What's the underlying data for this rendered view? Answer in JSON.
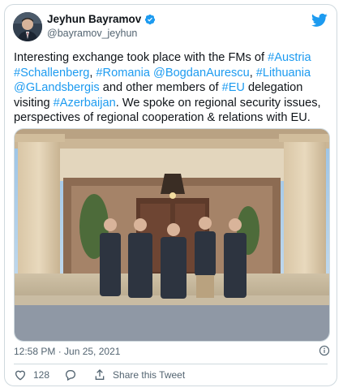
{
  "tweet": {
    "author": {
      "display_name": "Jeyhun Bayramov",
      "handle": "@bayramov_jeyhun",
      "verified": true
    },
    "text_segments": [
      {
        "t": "Interesting exchange took place with the FMs of ",
        "link": false
      },
      {
        "t": "#Austria",
        "link": true
      },
      {
        "t": " ",
        "link": false
      },
      {
        "t": "#Schallenberg",
        "link": true
      },
      {
        "t": ", ",
        "link": false
      },
      {
        "t": "#Romania",
        "link": true
      },
      {
        "t": " ",
        "link": false
      },
      {
        "t": "@BogdanAurescu",
        "link": true
      },
      {
        "t": ", ",
        "link": false
      },
      {
        "t": "#Lithuania",
        "link": true
      },
      {
        "t": " ",
        "link": false
      },
      {
        "t": "@GLandsbergis",
        "link": true
      },
      {
        "t": " and other members of ",
        "link": false
      },
      {
        "t": "#EU",
        "link": true
      },
      {
        "t": " delegation visiting ",
        "link": false
      },
      {
        "t": "#Azerbaijan",
        "link": true
      },
      {
        "t": ". We spoke on regional security issues, perspectives of regional cooperation & relations with EU.",
        "link": false
      }
    ],
    "timestamp": "12:58 PM · Jun 25, 2021",
    "like_count": "128",
    "share_label": "Share this Tweet"
  },
  "colors": {
    "link": "#1d9bf0",
    "text": "#0f1419",
    "muted": "#536471",
    "border": "#cfd9de"
  },
  "icons": [
    "verified-badge-icon",
    "twitter-bird-icon",
    "info-icon",
    "heart-icon",
    "reply-icon",
    "share-icon"
  ]
}
